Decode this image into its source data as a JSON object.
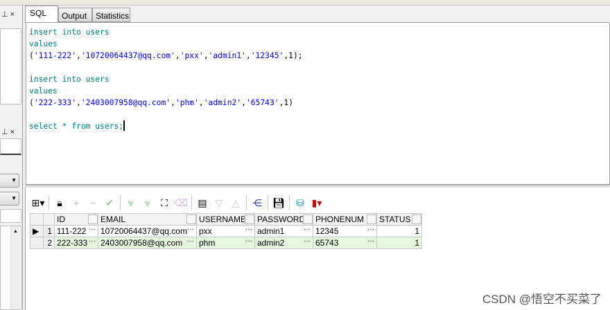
{
  "tabs": [
    "SQL",
    "Output",
    "Statistics"
  ],
  "editor": {
    "lines": [
      {
        "kw": "insert into users"
      },
      {
        "kw": "values"
      },
      {
        "vals": [
          "'111-222'",
          "'10720064437@qq.com'",
          "'pxx'",
          "'admin1'",
          "'12345'"
        ],
        "num": "1",
        "end": ");"
      },
      {},
      {
        "kw": "insert into users"
      },
      {
        "kw": "values"
      },
      {
        "vals": [
          "'222-333'",
          "'2403007958@qq.com'",
          "'phm'",
          "'admin2'",
          "'65743'"
        ],
        "num": "1",
        "end": ")"
      },
      {},
      {
        "kw": "select * from users;"
      }
    ]
  },
  "grid": {
    "columns": [
      "ID",
      "EMAIL",
      "USERNAME",
      "PASSWORD",
      "PHONENUM",
      "STATUS"
    ],
    "rows": [
      {
        "n": "1",
        "cells": [
          "111-222",
          "10720064437@qq.com",
          "pxx",
          "admin1",
          "12345",
          "1"
        ]
      },
      {
        "n": "2",
        "cells": [
          "222-333",
          "2403007958@qq.com",
          "phm",
          "admin2",
          "65743",
          "1"
        ]
      }
    ]
  },
  "watermark": "CSDN @悟空不买菜了"
}
